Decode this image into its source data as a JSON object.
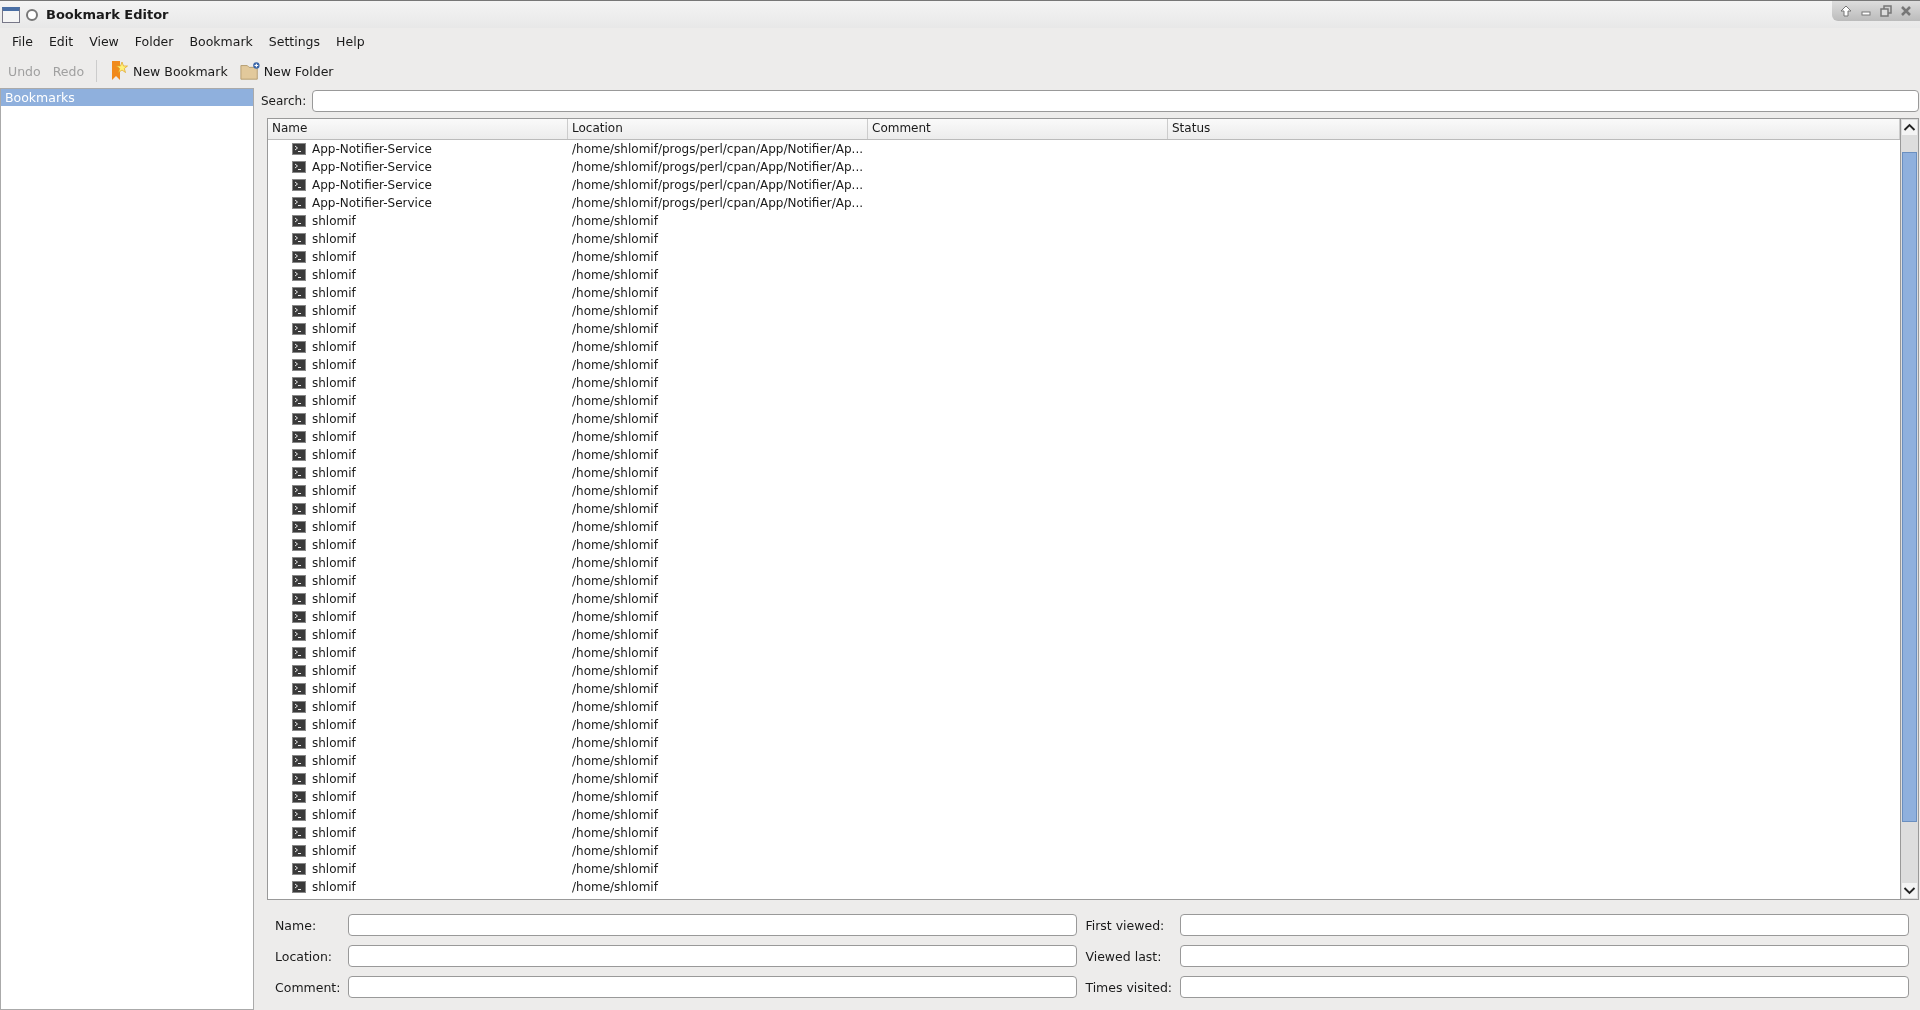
{
  "window": {
    "title": "Bookmark Editor"
  },
  "menu": [
    "File",
    "Edit",
    "View",
    "Folder",
    "Bookmark",
    "Settings",
    "Help"
  ],
  "toolbar": [
    {
      "kind": "text",
      "label": "Undo",
      "disabled": true
    },
    {
      "kind": "text",
      "label": "Redo",
      "disabled": true
    },
    {
      "kind": "separator"
    },
    {
      "kind": "bookmark",
      "label": "New Bookmark",
      "disabled": false
    },
    {
      "kind": "folder",
      "label": "New Folder",
      "disabled": false
    }
  ],
  "sidebar": {
    "items": [
      {
        "label": "Bookmarks",
        "selected": true
      }
    ]
  },
  "search": {
    "label": "Search:"
  },
  "table": {
    "columns": [
      "Name",
      "Location",
      "Comment",
      "Status"
    ],
    "rows": [
      {
        "name": "App-Notifier-Service",
        "location": "/home/shlomif/progs/perl/cpan/App/Notifier/Ap..."
      },
      {
        "name": "App-Notifier-Service",
        "location": "/home/shlomif/progs/perl/cpan/App/Notifier/Ap..."
      },
      {
        "name": "App-Notifier-Service",
        "location": "/home/shlomif/progs/perl/cpan/App/Notifier/Ap..."
      },
      {
        "name": "App-Notifier-Service",
        "location": "/home/shlomif/progs/perl/cpan/App/Notifier/Ap..."
      },
      {
        "name": "shlomif",
        "location": "/home/shlomif"
      },
      {
        "name": "shlomif",
        "location": "/home/shlomif"
      },
      {
        "name": "shlomif",
        "location": "/home/shlomif"
      },
      {
        "name": "shlomif",
        "location": "/home/shlomif"
      },
      {
        "name": "shlomif",
        "location": "/home/shlomif"
      },
      {
        "name": "shlomif",
        "location": "/home/shlomif"
      },
      {
        "name": "shlomif",
        "location": "/home/shlomif"
      },
      {
        "name": "shlomif",
        "location": "/home/shlomif"
      },
      {
        "name": "shlomif",
        "location": "/home/shlomif"
      },
      {
        "name": "shlomif",
        "location": "/home/shlomif"
      },
      {
        "name": "shlomif",
        "location": "/home/shlomif"
      },
      {
        "name": "shlomif",
        "location": "/home/shlomif"
      },
      {
        "name": "shlomif",
        "location": "/home/shlomif"
      },
      {
        "name": "shlomif",
        "location": "/home/shlomif"
      },
      {
        "name": "shlomif",
        "location": "/home/shlomif"
      },
      {
        "name": "shlomif",
        "location": "/home/shlomif"
      },
      {
        "name": "shlomif",
        "location": "/home/shlomif"
      },
      {
        "name": "shlomif",
        "location": "/home/shlomif"
      },
      {
        "name": "shlomif",
        "location": "/home/shlomif"
      },
      {
        "name": "shlomif",
        "location": "/home/shlomif"
      },
      {
        "name": "shlomif",
        "location": "/home/shlomif"
      },
      {
        "name": "shlomif",
        "location": "/home/shlomif"
      },
      {
        "name": "shlomif",
        "location": "/home/shlomif"
      },
      {
        "name": "shlomif",
        "location": "/home/shlomif"
      },
      {
        "name": "shlomif",
        "location": "/home/shlomif"
      },
      {
        "name": "shlomif",
        "location": "/home/shlomif"
      },
      {
        "name": "shlomif",
        "location": "/home/shlomif"
      },
      {
        "name": "shlomif",
        "location": "/home/shlomif"
      },
      {
        "name": "shlomif",
        "location": "/home/shlomif"
      },
      {
        "name": "shlomif",
        "location": "/home/shlomif"
      },
      {
        "name": "shlomif",
        "location": "/home/shlomif"
      },
      {
        "name": "shlomif",
        "location": "/home/shlomif"
      },
      {
        "name": "shlomif",
        "location": "/home/shlomif"
      },
      {
        "name": "shlomif",
        "location": "/home/shlomif"
      },
      {
        "name": "shlomif",
        "location": "/home/shlomif"
      },
      {
        "name": "shlomif",
        "location": "/home/shlomif"
      },
      {
        "name": "shlomif",
        "location": "/home/shlomif"
      },
      {
        "name": "shlomif",
        "location": "/home/shlomif"
      }
    ]
  },
  "form": {
    "left": [
      "Name:",
      "Location:",
      "Comment:"
    ],
    "right": [
      "First viewed:",
      "Viewed last:",
      "Times visited:"
    ]
  }
}
